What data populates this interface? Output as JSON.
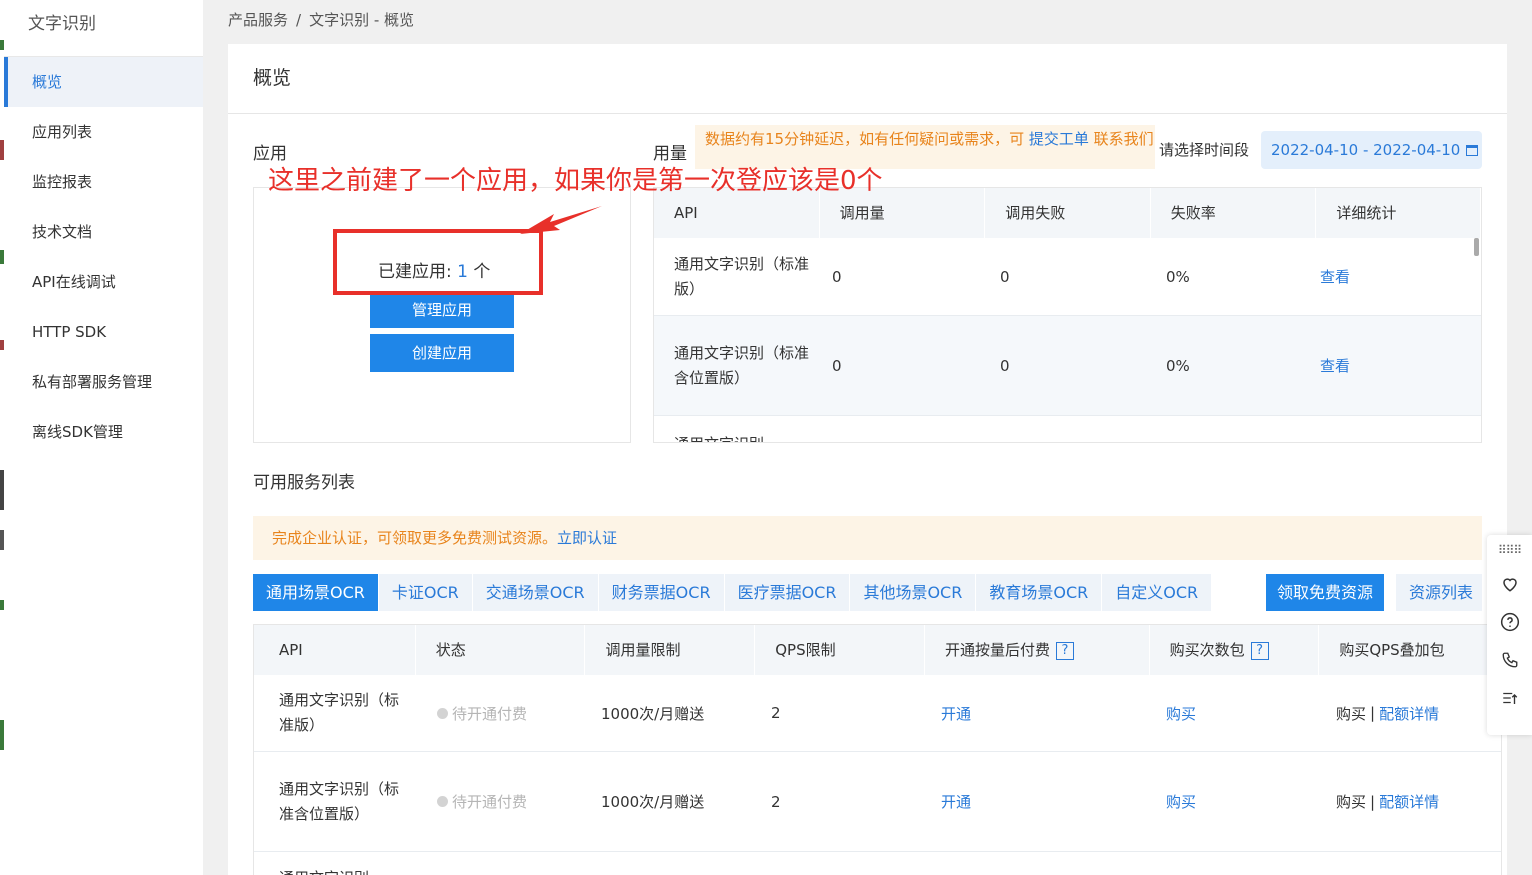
{
  "sidebar": {
    "title": "文字识别",
    "items": [
      {
        "label": "概览"
      },
      {
        "label": "应用列表"
      },
      {
        "label": "监控报表"
      },
      {
        "label": "技术文档"
      },
      {
        "label": "API在线调试"
      },
      {
        "label": "HTTP SDK"
      },
      {
        "label": "私有部署服务管理"
      },
      {
        "label": "离线SDK管理"
      }
    ]
  },
  "breadcrumb": {
    "parent": "产品服务",
    "separator": "/",
    "current": "文字识别 - 概览"
  },
  "page": {
    "title": "概览"
  },
  "apps": {
    "heading": "应用",
    "built_label": "已建应用:",
    "built_count": "1",
    "built_unit": "个",
    "manage_button": "管理应用",
    "create_button": "创建应用"
  },
  "annotation": {
    "text": "这里之前建了一个应用，如果你是第一次登应该是0个"
  },
  "usage": {
    "heading": "用量",
    "notice_prefix": "数据约有15分钟延迟，如有任何疑问或需求，可",
    "notice_link": "提交工单",
    "notice_suffix": "联系我们",
    "period_label": "请选择时间段",
    "date_range": "2022-04-10 - 2022-04-10",
    "columns": [
      "API",
      "调用量",
      "调用失败",
      "失败率",
      "详细统计"
    ],
    "rows": [
      {
        "api": "通用文字识别（标准版）",
        "calls": "0",
        "failed": "0",
        "rate": "0%",
        "detail": "查看"
      },
      {
        "api": "通用文字识别（标准含位置版）",
        "calls": "0",
        "failed": "0",
        "rate": "0%",
        "detail": "查看"
      },
      {
        "api": "通用文字识别",
        "calls": "",
        "failed": "",
        "rate": "",
        "detail": ""
      }
    ]
  },
  "services": {
    "heading": "可用服务列表",
    "cert_text": "完成企业认证，可领取更多免费测试资源。",
    "cert_link": "立即认证",
    "tabs": [
      "通用场景OCR",
      "卡证OCR",
      "交通场景OCR",
      "财务票据OCR",
      "医疗票据OCR",
      "其他场景OCR",
      "教育场景OCR",
      "自定义OCR"
    ],
    "free_button": "领取免费资源",
    "resource_list": "资源列表",
    "columns": [
      "API",
      "状态",
      "调用量限制",
      "QPS限制",
      "开通按量后付费",
      "购买次数包",
      "购买QPS叠加包"
    ],
    "rows": [
      {
        "api": "通用文字识别（标准版）",
        "status": "待开通付费",
        "limit": "1000次/月赠送",
        "qps": "2",
        "open": "开通",
        "buy": "购买",
        "qps_buy": "购买",
        "qps_sep": "|",
        "quota": "配额详情"
      },
      {
        "api": "通用文字识别（标准含位置版）",
        "status": "待开通付费",
        "limit": "1000次/月赠送",
        "qps": "2",
        "open": "开通",
        "buy": "购买",
        "qps_buy": "购买",
        "qps_sep": "|",
        "quota": "配额详情"
      },
      {
        "api": "通用文字识别"
      }
    ]
  },
  "rightbar": {
    "icons": [
      "drag-handle-icon",
      "heart-icon",
      "help-icon",
      "phone-icon",
      "list-up-icon"
    ]
  },
  "colors": {
    "accent": "#1f86e8",
    "warning": "#e8841c",
    "annotation": "#e8302a"
  }
}
